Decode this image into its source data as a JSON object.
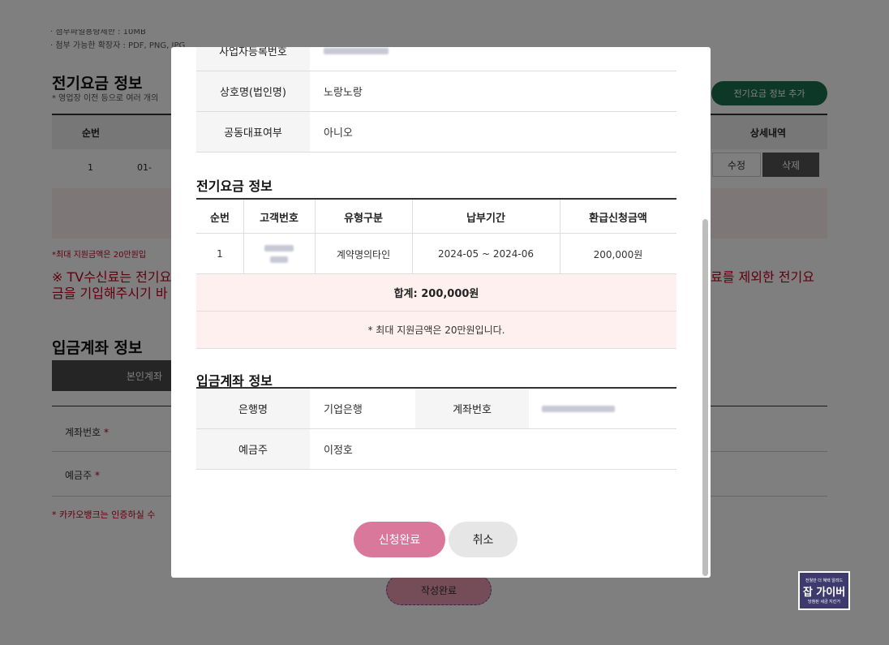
{
  "background": {
    "attach_size_note": "· 첨부파일용량제한 : 10MB",
    "attach_ext_note": "· 첨부 가능한 확장자 : PDF, PNG, JPG",
    "elec_title": "전기요금 정보",
    "elec_subnote": "* 영업장 이전 등으로 여러 개의",
    "add_button": "전기요금 정보 추가",
    "col_no": "순번",
    "col_detail": "상세내역",
    "row_no": "1",
    "row_frag": "01-",
    "edit_button": "수정",
    "delete_button": "삭제",
    "max_support_note": "*최대 지원금액은 20만원입",
    "tv_note_left_1": "※ TV수신료는 전기요",
    "tv_note_left_2": "금을 기입해주시기 바",
    "tv_note_right": "료를 제외한 전기요",
    "account_title": "입금계좌 정보",
    "tab_self": "본인계좌",
    "acct_no_label": "계좌번호",
    "holder_label": "예금주",
    "kakao_note": "* 카카오뱅크는 인증하실 수",
    "submit_button": "작성완료"
  },
  "badge": {
    "top": "전월만 더 혜택 알려드",
    "main": "잡 가이버",
    "bottom": "당첨된 세금 지킨거"
  },
  "modal": {
    "biz_reg_label": "사업자등록번호",
    "company_label": "상호명(법인명)",
    "company_value": "노랑노랑",
    "joint_label": "공동대표여부",
    "joint_value": "아니오",
    "elec_title": "전기요금 정보",
    "table": {
      "headers": [
        "순번",
        "고객번호",
        "유형구분",
        "납부기간",
        "환급신청금액"
      ],
      "rows": [
        {
          "no": "1",
          "type": "계약명의타인",
          "period": "2024-05 ~ 2024-06",
          "amount": "200,000원"
        }
      ],
      "total": "합계: 200,000원",
      "note": "* 최대 지원금액은 20만원입니다."
    },
    "account_title": "입금계좌 정보",
    "bank_label": "은행명",
    "bank_value": "기업은행",
    "acct_no_label": "계좌번호",
    "holder_label": "예금주",
    "holder_value": "이정호",
    "submit_button": "신청완료",
    "cancel_button": "취소"
  },
  "colors": {
    "overlay": "#808080",
    "accent_pink": "#d9789a",
    "brand_green": "#1a6e4c",
    "alert_red": "#c0001d"
  }
}
